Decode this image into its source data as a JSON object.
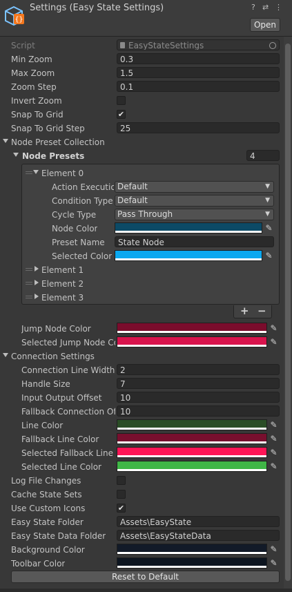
{
  "header": {
    "title": "Settings (Easy State Settings)",
    "help_icon": "help-icon",
    "tools": [
      "?",
      "⇄",
      "⋮"
    ],
    "open_label": "Open"
  },
  "script": {
    "label": "Script",
    "value": "EasyStateSettings"
  },
  "fields": [
    {
      "label": "Min Zoom",
      "value": "0.3"
    },
    {
      "label": "Max Zoom",
      "value": "1.5"
    },
    {
      "label": "Zoom Step",
      "value": "0.1"
    }
  ],
  "toggles_top": [
    {
      "label": "Invert Zoom",
      "checked": false,
      "mark": ""
    },
    {
      "label": "Snap To Grid",
      "checked": true,
      "mark": "✔"
    }
  ],
  "grid_step": {
    "label": "Snap To Grid Step",
    "value": "25"
  },
  "node_preset_collection": {
    "label": "Node Preset Collection",
    "presets_label": "Node Presets",
    "count": "4",
    "element0": {
      "label": "Element 0",
      "action": {
        "label": "Action Execution",
        "value": "Default"
      },
      "condition": {
        "label": "Condition Type",
        "value": "Default"
      },
      "cycle": {
        "label": "Cycle Type",
        "value": "Pass Through"
      },
      "node_color": {
        "label": "Node Color",
        "color": "#0c4a66"
      },
      "preset_name": {
        "label": "Preset Name",
        "value": "State Node"
      },
      "selected_color": {
        "label": "Selected Color",
        "color": "#0aa8f0"
      }
    },
    "collapsed": [
      "Element 1",
      "Element 2",
      "Element 3"
    ],
    "add": "+",
    "remove": "−"
  },
  "jump_colors": [
    {
      "label": "Jump Node Color",
      "color": "#7a0c2c"
    },
    {
      "label": "Selected Jump Node Color",
      "color": "#d9144d"
    }
  ],
  "connection": {
    "label": "Connection Settings",
    "fields": [
      {
        "label": "Connection Line Width",
        "value": "2"
      },
      {
        "label": "Handle Size",
        "value": "7"
      },
      {
        "label": "Input Output Offset",
        "value": "10"
      },
      {
        "label": "Fallback Connection Offset",
        "value": "10"
      }
    ],
    "colors": [
      {
        "label": "Line Color",
        "color": "#2a4d26"
      },
      {
        "label": "Fallback Line Color",
        "color": "#780f2e"
      },
      {
        "label": "Selected Fallback Line Color",
        "color": "#ff1556"
      },
      {
        "label": "Selected Line Color",
        "color": "#3fb646"
      }
    ]
  },
  "bottom_toggles": [
    {
      "label": "Log File Changes",
      "checked": false,
      "mark": ""
    },
    {
      "label": "Cache State Sets",
      "checked": false,
      "mark": ""
    },
    {
      "label": "Use Custom Icons",
      "checked": true,
      "mark": "✔"
    }
  ],
  "folders": [
    {
      "label": "Easy State Folder",
      "value": "Assets\\EasyState"
    },
    {
      "label": "Easy State Data Folder",
      "value": "Assets\\EasyStateData"
    }
  ],
  "ui_colors": [
    {
      "label": "Background Color",
      "color": "#121a28"
    },
    {
      "label": "Toolbar Color",
      "color": "#0d1520"
    }
  ],
  "reset_label": "Reset to Default"
}
